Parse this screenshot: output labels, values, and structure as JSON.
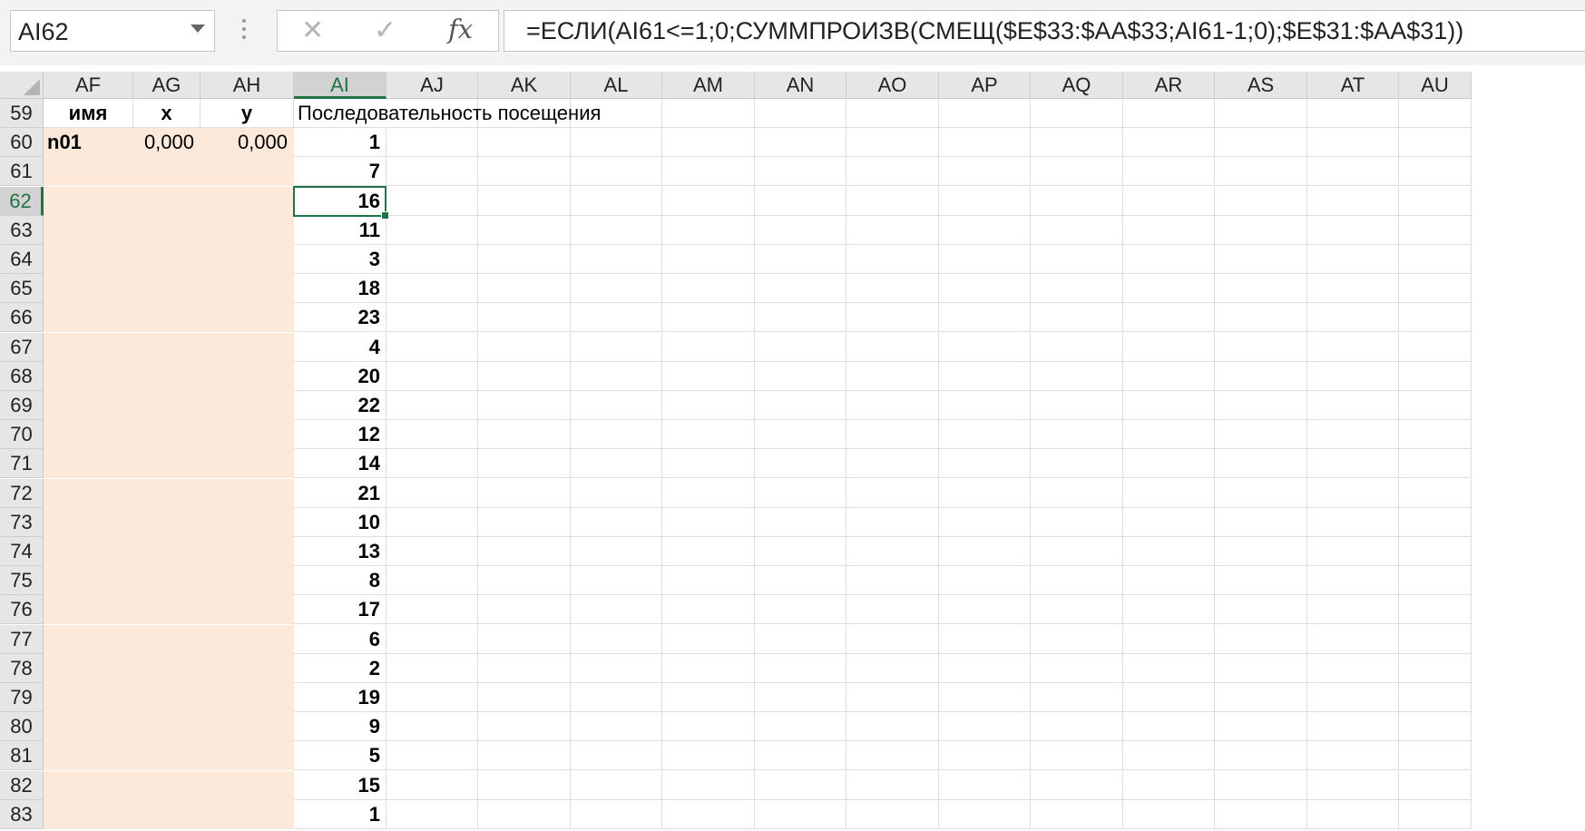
{
  "name_box": {
    "value": "AI62"
  },
  "formula_bar": {
    "cancel_glyph": "✕",
    "enter_glyph": "✓",
    "fx_label": "fx",
    "formula": "=ЕСЛИ(AI61<=1;0;СУММПРОИЗВ(СМЕЩ($E$33:$AA$33;AI61-1;0);$E$31:$AA$31))"
  },
  "columns": [
    "AF",
    "AG",
    "AH",
    "AI",
    "AJ",
    "AK",
    "AL",
    "AM",
    "AN",
    "AO",
    "AP",
    "AQ",
    "AR",
    "AS",
    "AT",
    "AU"
  ],
  "selected_column": "AI",
  "rows": [
    59,
    60,
    61,
    62,
    63,
    64,
    65,
    66,
    67,
    68,
    69,
    70,
    71,
    72,
    73,
    74,
    75,
    76,
    77,
    78,
    79,
    80,
    81,
    82,
    83
  ],
  "selected_row": 62,
  "header_row": {
    "af": "имя",
    "ag": "x",
    "ah": "y",
    "ai": "Последовательность посещения"
  },
  "first_node": {
    "name": "n01",
    "x": "0,000",
    "y": "0,000"
  },
  "sequence": [
    "1",
    "7",
    "16",
    "11",
    "3",
    "18",
    "23",
    "4",
    "20",
    "22",
    "12",
    "14",
    "21",
    "10",
    "13",
    "8",
    "17",
    "6",
    "2",
    "19",
    "9",
    "5",
    "15",
    "1"
  ],
  "colors": {
    "fill": "#fde9d9",
    "accent": "#217346"
  }
}
